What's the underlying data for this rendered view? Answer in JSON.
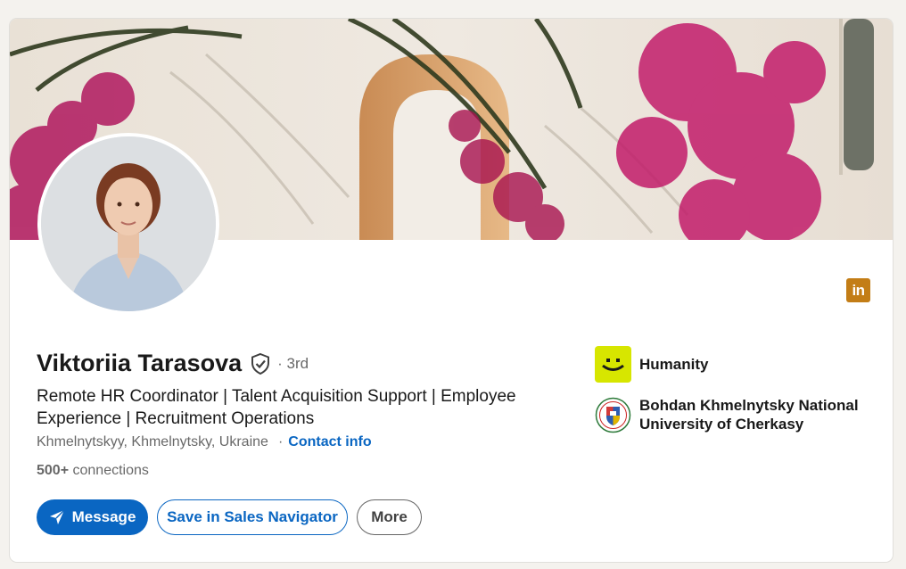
{
  "profile": {
    "name": "Viktoriia Tarasova",
    "degree": "· 3rd",
    "headline_line1": "Remote HR Coordinator | Talent Acquisition Support | Employee",
    "headline_line2": "Experience | Recruitment Operations",
    "location": "Khmelnytskyy, Khmelnytsky, Ukraine",
    "location_separator": "·",
    "contact_info": "Contact info",
    "connections_count": "500+",
    "connections_label": "connections"
  },
  "actions": {
    "message": "Message",
    "save_sales_navigator": "Save in Sales Navigator",
    "more": "More"
  },
  "organizations": [
    {
      "name": "Humanity",
      "logo_color": "#d7e600"
    },
    {
      "name_line1": "Bohdan Khmelnytsky National",
      "name_line2": "University of Cherkasy"
    }
  ],
  "linkedin_badge": "in",
  "colors": {
    "brand_blue": "#0a66c2",
    "linkedin_badge": "#c37d16"
  },
  "icons": [
    "verified-shield-icon",
    "paper-plane-icon",
    "linkedin-icon",
    "humanity-logo-icon",
    "university-crest-icon"
  ]
}
